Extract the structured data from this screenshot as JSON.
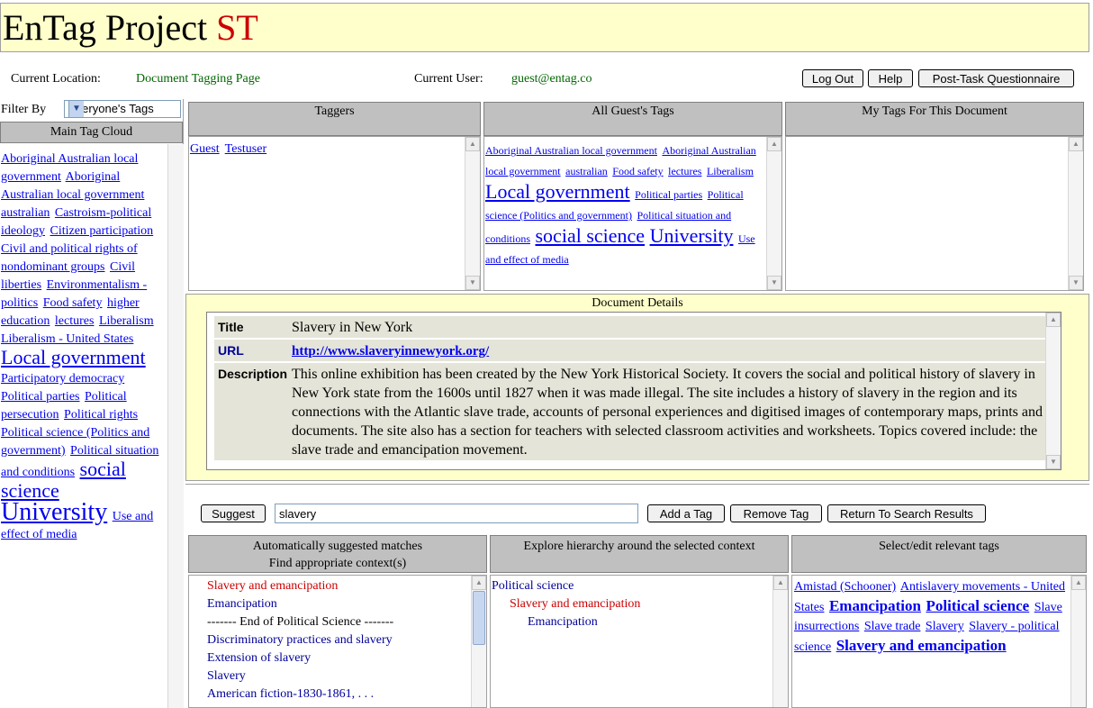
{
  "header": {
    "title_main": "EnTag Project",
    "title_suffix": "ST"
  },
  "info": {
    "location_label": "Current Location:",
    "location_value": "Document Tagging Page",
    "user_label": "Current User:",
    "user_value": "guest@entag.co"
  },
  "top_buttons": {
    "logout": "Log Out",
    "help": "Help",
    "questionnaire": "Post-Task Questionnaire"
  },
  "sidebar": {
    "filter_label": "Filter By",
    "filter_value": "Everyone's Tags",
    "cloud_title": "Main Tag Cloud",
    "tags": [
      {
        "text": "Aboriginal Australian local government",
        "size": "s"
      },
      {
        "text": "Aboriginal Australian local government",
        "size": "s"
      },
      {
        "text": "australian",
        "size": "s"
      },
      {
        "text": "Castroism-political ideology",
        "size": "s"
      },
      {
        "text": "Citizen participation",
        "size": "s"
      },
      {
        "text": "Civil and political rights of nondominant groups",
        "size": "s"
      },
      {
        "text": "Civil liberties",
        "size": "s"
      },
      {
        "text": "Environmentalism - politics",
        "size": "s"
      },
      {
        "text": "Food safety",
        "size": "s"
      },
      {
        "text": "higher education",
        "size": "s"
      },
      {
        "text": "lectures",
        "size": "s"
      },
      {
        "text": "Liberalism",
        "size": "s"
      },
      {
        "text": "Liberalism - United States",
        "size": "s"
      },
      {
        "text": "Local government",
        "size": "l"
      },
      {
        "text": "Participatory democracy",
        "size": "s"
      },
      {
        "text": "Political parties",
        "size": "s"
      },
      {
        "text": "Political persecution",
        "size": "s"
      },
      {
        "text": "Political rights",
        "size": "s"
      },
      {
        "text": "Political science (Politics and government)",
        "size": "s"
      },
      {
        "text": "Political situation and conditions",
        "size": "s"
      },
      {
        "text": "social science",
        "size": "l"
      },
      {
        "text": "University",
        "size": "xl"
      },
      {
        "text": "Use and effect of media",
        "size": "s"
      }
    ]
  },
  "taggers": {
    "title": "Taggers",
    "items": [
      "Guest",
      "Testuser"
    ]
  },
  "all_tags": {
    "title": "All Guest's Tags",
    "tags": [
      {
        "text": "Aboriginal Australian local government",
        "size": "s"
      },
      {
        "text": "Aboriginal Australian local government",
        "size": "s"
      },
      {
        "text": "australian",
        "size": "s"
      },
      {
        "text": "Food safety",
        "size": "s"
      },
      {
        "text": "lectures",
        "size": "s"
      },
      {
        "text": "Liberalism",
        "size": "s"
      },
      {
        "text": "Local government",
        "size": "l"
      },
      {
        "text": "Political parties",
        "size": "s"
      },
      {
        "text": "Political science (Politics and government)",
        "size": "s"
      },
      {
        "text": "Political situation and conditions",
        "size": "s"
      },
      {
        "text": "social science",
        "size": "l"
      },
      {
        "text": "University",
        "size": "l"
      },
      {
        "text": "Use and effect of media",
        "size": "s"
      }
    ]
  },
  "my_tags": {
    "title": "My Tags For This Document"
  },
  "details": {
    "caption": "Document Details",
    "title_label": "Title",
    "title_value": "Slavery in New York",
    "url_label": "URL",
    "url_value": "http://www.slaveryinnewyork.org/",
    "desc_label": "Description",
    "desc_value": "This online exhibition has been created by the New York Historical Society. It covers the social and political history of slavery in New York state from the 1600s until 1827 when it was made illegal. The site includes a history of slavery in the region and its connections with the Atlantic slave trade, accounts of personal experiences and digitised images of contemporary maps, prints and documents. The site also has a section for teachers with selected classroom activities and worksheets. Topics covered include: the slave trade and emancipation movement."
  },
  "tagbar": {
    "suggest": "Suggest",
    "input_value": "slavery",
    "add": "Add a Tag",
    "remove": "Remove Tag",
    "return": "Return To Search Results"
  },
  "suggested": {
    "title1": "Automatically suggested matches",
    "title2": "Find appropriate context(s)",
    "items": [
      {
        "text": "Slavery and emancipation",
        "cls": "red"
      },
      {
        "text": "Emancipation",
        "cls": "navy"
      },
      {
        "text": "------- End of Political Science -------",
        "cls": ""
      },
      {
        "text": "Discriminatory practices and slavery",
        "cls": "navy"
      },
      {
        "text": "Extension of slavery",
        "cls": "navy"
      },
      {
        "text": "Slavery",
        "cls": "navy"
      },
      {
        "text": "American fiction-1830-1861, . . .",
        "cls": "navy"
      }
    ]
  },
  "hierarchy": {
    "title": "Explore hierarchy around the selected context",
    "items": [
      {
        "text": "Political science",
        "cls": "navy",
        "indent": 0
      },
      {
        "text": "Slavery and emancipation",
        "cls": "red",
        "indent": 20
      },
      {
        "text": "Emancipation",
        "cls": "navy",
        "indent": 40
      }
    ]
  },
  "relevant": {
    "title": "Select/edit relevant tags",
    "tags": [
      {
        "text": "Amistad (Schooner)",
        "size": "s"
      },
      {
        "text": "Antislavery movements - United States",
        "size": "s"
      },
      {
        "text": "Emancipation",
        "size": "m"
      },
      {
        "text": "Political science",
        "size": "m"
      },
      {
        "text": "Slave insurrections",
        "size": "s"
      },
      {
        "text": "Slave trade",
        "size": "s"
      },
      {
        "text": "Slavery",
        "size": "s"
      },
      {
        "text": "Slavery - political science",
        "size": "s"
      },
      {
        "text": "Slavery and emancipation",
        "size": "m"
      }
    ]
  }
}
